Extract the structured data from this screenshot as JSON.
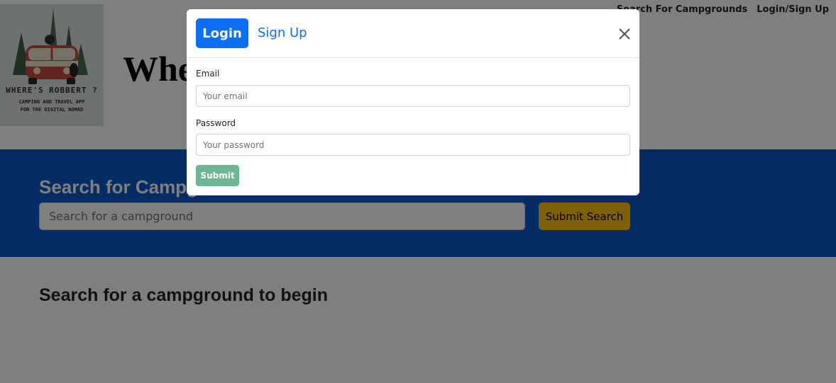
{
  "header": {
    "logo": {
      "line1": "WHERE'S ROBBERT ?",
      "line2": "CAMPING AND TRAVEL APP",
      "line3": "FOR THE DIGITAL NOMAD"
    },
    "title_partial": "Whe",
    "nav": {
      "search_link": "Search For Campgrounds",
      "login_link": "Login/Sign Up"
    }
  },
  "search": {
    "heading_partial": "Search for Campg",
    "placeholder": "Search for a campground",
    "submit_label": "Submit Search"
  },
  "results": {
    "message": "Search for a campground to begin"
  },
  "modal": {
    "tabs": {
      "login": "Login",
      "signup": "Sign Up"
    },
    "email_label": "Email",
    "email_placeholder": "Your email",
    "password_label": "Password",
    "password_placeholder": "Your password",
    "submit_label": "Submit"
  },
  "colors": {
    "primary": "#0d6efd",
    "search_band": "#0a58ca",
    "warning": "#ffc107",
    "submit_success": "#6db594"
  }
}
